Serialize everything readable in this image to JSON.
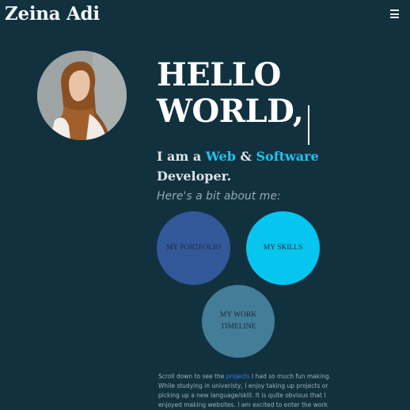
{
  "header": {
    "brand": "Zeina Adi",
    "menu_icon": "hamburger-menu-icon"
  },
  "hero": {
    "avatar_alt": "portrait-photo",
    "greeting": "HELLO WORLD,",
    "tagline": {
      "prefix": "I am a ",
      "word1": "Web",
      "and": " & ",
      "word2": "Software",
      "suffix": " Developer."
    },
    "about_intro": "Here's a bit about me:"
  },
  "nav_circles": {
    "portfolio": "MY PORTFOLIO",
    "skills": "MY SKILLS",
    "timeline": "MY WORK TIMELINE"
  },
  "bio": {
    "before_link": "Scroll down to see the ",
    "link": "projects",
    "after_link": " I had so much fun making. While studying in univeristy, I enjoy taking up projects or picking up a new language/skill. It is quite obvious that I enjoyed making websites. I am excited to enter the work"
  },
  "colors": {
    "background": "#11313f",
    "accent": "#1ec4ef",
    "portfolio": "#33589a",
    "skills": "#06c5ef",
    "timeline": "#447d97"
  }
}
